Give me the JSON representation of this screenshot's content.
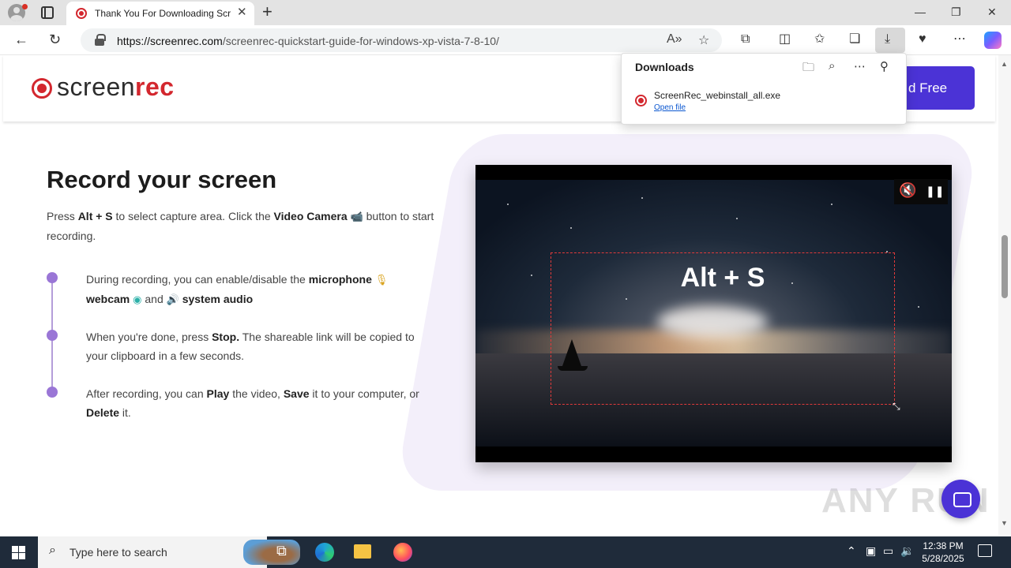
{
  "browser": {
    "tab_title": "Thank You For Downloading ScreenRec",
    "tab_close": "✕",
    "new_tab": "+",
    "url_host": "https://screenrec.com",
    "url_path": "/screenrec-quickstart-guide-for-windows-xp-vista-7-8-10/",
    "window_controls": {
      "minimize": "—",
      "restore": "❐",
      "close": "✕"
    },
    "icons": [
      "back-icon",
      "refresh-icon",
      "lock-icon",
      "read-aloud-icon",
      "favorite-star-icon",
      "extensions-icon",
      "split-screen-icon",
      "favorites-icon",
      "collections-icon",
      "downloads-icon",
      "performance-icon",
      "more-icon",
      "copilot-icon"
    ]
  },
  "site": {
    "logo_prefix": "screen",
    "logo_suffix": "rec",
    "cta_label": "d Free",
    "heading": "Record your screen",
    "intro": {
      "t1": "Press ",
      "b1": "Alt + S",
      "t2": " to select capture area. Click the ",
      "b2": "Video Camera",
      "icon": "📹",
      "t3": " button to start recording."
    },
    "steps": [
      {
        "t1": "During recording, you can enable/disable the ",
        "b1": "microphone",
        "i1": "🎙",
        "b2": "webcam",
        "i2": "◉",
        "t2": " and ",
        "i3": "🔊",
        "b3": "system audio"
      },
      {
        "t1": "When you're done, press ",
        "b1": "Stop.",
        "t2": " The shareable link will be copied to your clipboard in a few seconds."
      },
      {
        "t1": "After recording, you can ",
        "b1": "Play",
        "t2": " the video, ",
        "b2": "Save",
        "t3": " it to your computer, or ",
        "b3": "Delete",
        "t4": " it."
      }
    ],
    "video": {
      "selection_label": "Alt + S",
      "mute_icon": "🔇",
      "pause_icon": "❚❚",
      "toolbar_icons": "▸📷🎥🖼⚙",
      "resize_icon": "⤡"
    },
    "watermark": "ANY RUN"
  },
  "downloads": {
    "title": "Downloads",
    "file_name": "ScreenRec_webinstall_all.exe",
    "open_file": "Open file",
    "icons": [
      "open-folder-icon",
      "search-icon",
      "more-icon",
      "pin-icon"
    ]
  },
  "taskbar": {
    "search_placeholder": "Type here to search",
    "time": "12:38 PM",
    "date": "5/28/2025"
  }
}
